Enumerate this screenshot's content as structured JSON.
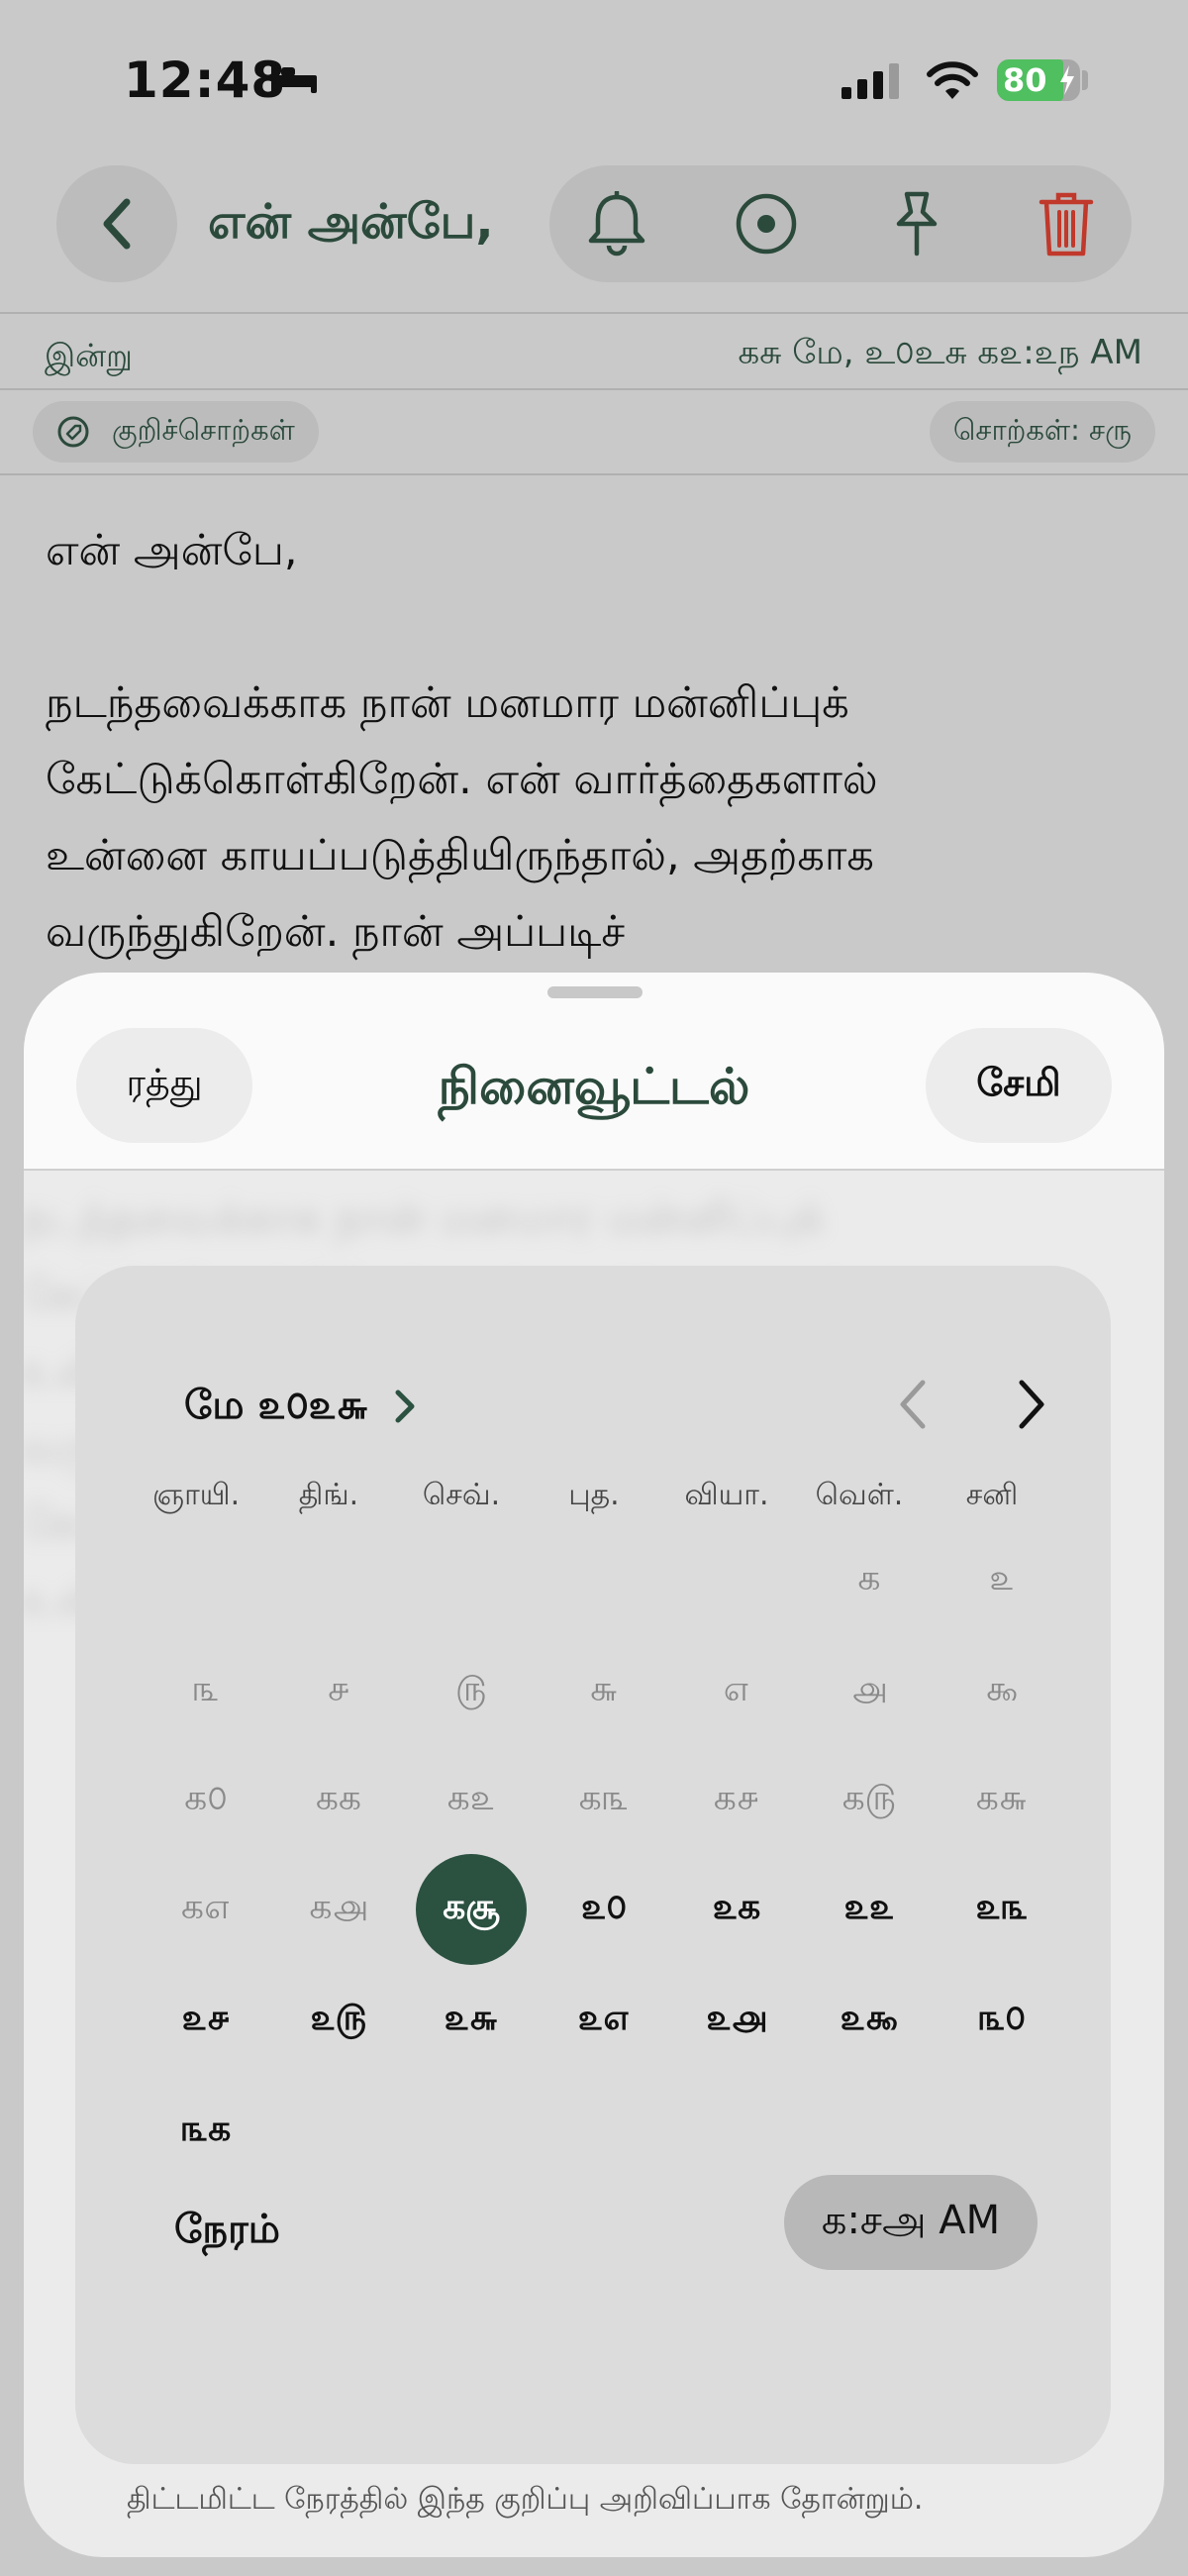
{
  "status": {
    "time": "12:48",
    "battery": "80"
  },
  "header": {
    "title": "என் அன்பே,"
  },
  "meta": {
    "today": "இன்று",
    "date": "கசு மே, உ௦உசு க௨:௨ந AM"
  },
  "chips": {
    "tags": "குறிச்சொற்கள்",
    "words": "சொற்கள்: சரு"
  },
  "note": {
    "greeting": "என் அன்பே,",
    "line1": "நடந்தவைக்காக நான் மனமார மன்னிப்புக்",
    "line2": "கேட்டுக்கொள்கிறேன். என் வார்த்தைகளால்",
    "line3": "உன்னை காயப்படுத்தியிருந்தால், அதற்காக",
    "line4": "வருந்துகிறேன். நான் அப்படிச்"
  },
  "sheet": {
    "cancel": "ரத்து",
    "title": "நினைவூட்டல்",
    "save": "சேமி",
    "month": "மே ௨௦௨௬",
    "weekdays": [
      "ஞாயி.",
      "திங்.",
      "செவ்.",
      "புத.",
      "வியா.",
      "வெள்.",
      "சனி"
    ],
    "days": [
      "க",
      "௨",
      "௩",
      "௪",
      "௫",
      "௬",
      "௭",
      "௮",
      "௯",
      "க௦",
      "கக",
      "க௨",
      "க௩",
      "க௪",
      "க௫",
      "க௬",
      "க௭",
      "க௮",
      "கசூ",
      "௨௦",
      "௨க",
      "௨௨",
      "௨௩",
      "௨௪",
      "௨௫",
      "௨௬",
      "௨௭",
      "௨௮",
      "௨௯",
      "௩௦",
      "௩க"
    ],
    "time_label": "நேரம்",
    "time_value": "க:சஅ AM",
    "footer": "திட்டமிட்ட நேரத்தில் இந்த குறிப்பு அறிவிப்பாக தோன்றும்."
  },
  "colors": {
    "accent": "#2b4a3c",
    "delete": "#c0392b",
    "selected": "#2b5141"
  },
  "icons": [
    "back-icon",
    "bell-icon",
    "record-icon",
    "pin-icon",
    "trash-icon",
    "tag-icon",
    "chevron-right-icon",
    "chevron-left-icon"
  ]
}
